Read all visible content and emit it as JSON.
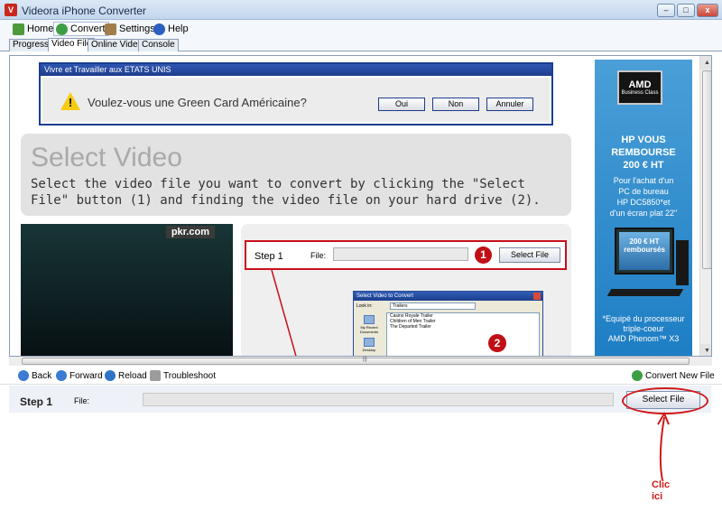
{
  "window": {
    "title": "Videora iPhone Converter"
  },
  "menu": {
    "home": "Home",
    "convert": "Convert",
    "settings": "Settings",
    "help": "Help"
  },
  "tabs": [
    "Progress",
    "Video File",
    "Online Video",
    "Console"
  ],
  "ad": {
    "header": "Vivre et Travailler aux ETATS UNIS",
    "question": "Voulez-vous une Green Card Américaine?",
    "buttons": [
      "Oui",
      "Non",
      "Annuler"
    ]
  },
  "select_video": {
    "title": "Select Video",
    "description": "Select the video file you want to convert by clicking the \"Select File\" button (1) and finding the video file on your hard drive (2)."
  },
  "video": {
    "site_label": "pkr.com"
  },
  "step1": {
    "label": "Step 1",
    "file_label": "File:",
    "button": "Select File",
    "badge1": "1",
    "badge2": "2"
  },
  "mini_dialog": {
    "title": "Select Video to Convert",
    "look_in_label": "Look in:",
    "look_in_value": "Trailers",
    "files": [
      "Casino Royale Trailer",
      "Children of Men Trailer",
      "The Departed Trailer"
    ],
    "sidebar": [
      "My Recent Documents",
      "Desktop"
    ]
  },
  "banner": {
    "logo": "AMD",
    "logo_sub": "Business Class",
    "headline": [
      "HP VOUS",
      "REMBOURSE",
      "200 € HT"
    ],
    "sub": [
      "Pour l'achat d'un",
      "PC de bureau",
      "HP DC5850*et",
      "d'un écran plat 22\""
    ],
    "monitor_text": [
      "200 € HT",
      "remboursés"
    ],
    "footnote": [
      "*Equipé du processeur",
      "triple-coeur",
      "AMD Phenom™ X3"
    ]
  },
  "nav": {
    "back": "Back",
    "forward": "Forward",
    "reload": "Reload",
    "troubleshoot": "Troubleshoot",
    "convert_new": "Convert New File"
  },
  "bottom_step": {
    "label": "Step 1",
    "file_label": "File:",
    "button": "Select File"
  },
  "annotation": {
    "line1": "Clic",
    "line2": "ici"
  },
  "colors": {
    "accent_red": "#d01818",
    "banner_blue": "#1e7ec4",
    "ad_blue": "#1a3e92"
  }
}
